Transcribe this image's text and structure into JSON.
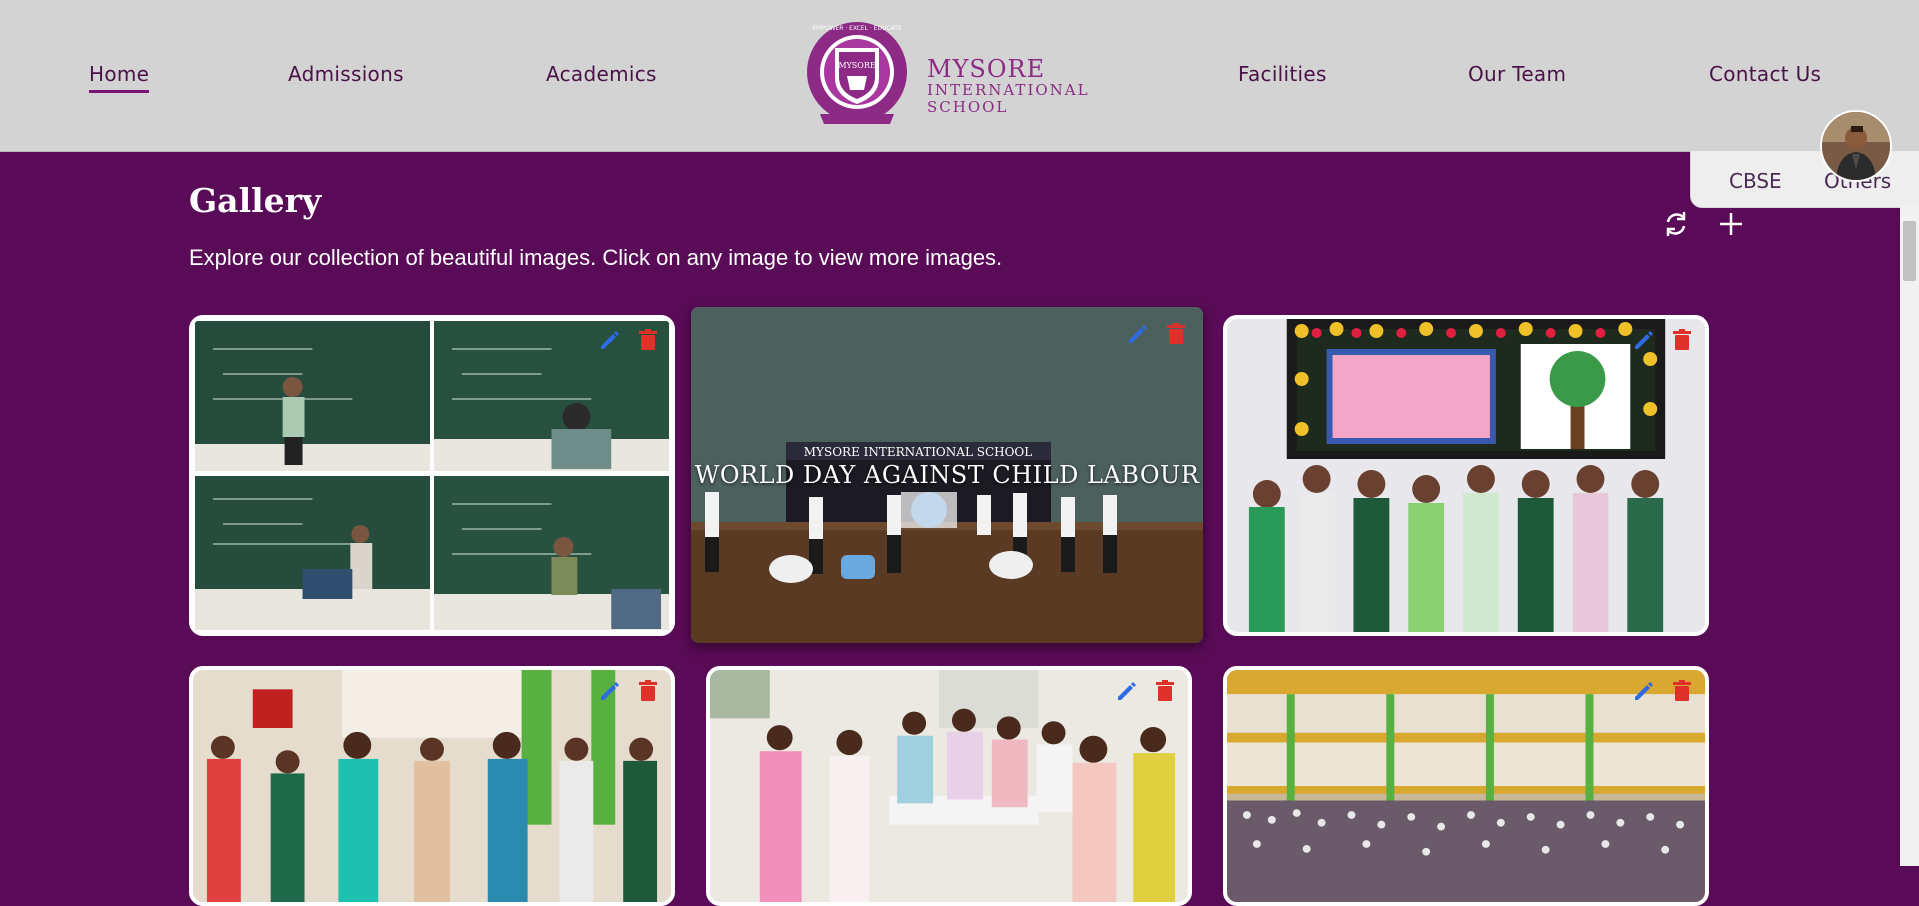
{
  "nav": {
    "left": [
      "Home",
      "Admissions",
      "Academics"
    ],
    "right": [
      "Facilities",
      "Our Team",
      "Contact Us"
    ],
    "active": "Home"
  },
  "logo": {
    "line1": "MYSORE",
    "line2": "INTERNATIONAL",
    "line3": "SCHOOL",
    "ring_text": "EMPOWER · EXCEL · EDUCATE",
    "badge_text": "MYSORE"
  },
  "popout": {
    "items": [
      "CBSE",
      "Others"
    ]
  },
  "gallery": {
    "title": "Gallery",
    "subtitle": "Explore our collection of beautiful images. Click on any image to view more images.",
    "refresh_icon": "refresh-icon",
    "add_icon": "plus-icon",
    "cards": [
      {
        "caption": "",
        "scene": "classroom-collage"
      },
      {
        "caption": "WORLD DAY AGAINST CHILD LABOUR",
        "scene": "stage-event",
        "banner": "MYSORE INTERNATIONAL SCHOOL"
      },
      {
        "caption": "",
        "scene": "kids-group"
      },
      {
        "caption": "",
        "scene": "teachers-group"
      },
      {
        "caption": "",
        "scene": "teachers-seated"
      },
      {
        "caption": "",
        "scene": "school-atrium"
      }
    ]
  },
  "colors": {
    "page_bg": "#5a0b57",
    "header_bg": "#d3d3d3",
    "brand_purple": "#8c2a86",
    "edit_blue": "#2d6be4",
    "delete_red": "#e0302a"
  }
}
